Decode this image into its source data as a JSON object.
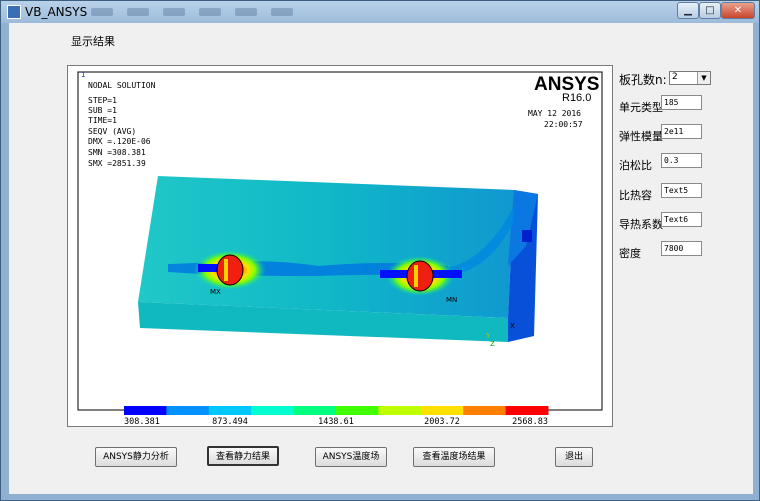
{
  "window": {
    "title": "VB_ANSYS"
  },
  "menu": {
    "show_results": "显示结果"
  },
  "plot": {
    "header_lines": [
      "NODAL SOLUTION",
      "STEP=1",
      "SUB =1",
      "TIME=1",
      "SEQV      (AVG)",
      "DMX =.120E-06",
      "SMN =308.381",
      "SMX =2851.39"
    ],
    "brand": "ANSYS",
    "version": "R16.0",
    "date": "MAY 12 2016",
    "time": "22:00:57",
    "marker_mx": "MX",
    "marker_mn": "MN",
    "marker_x": "X",
    "marker_y": "Y",
    "marker_z": "Z",
    "marker_1": "1",
    "legend_values": [
      "308.381",
      "873.494",
      "1438.61",
      "2003.72",
      "2568.83"
    ],
    "legend_colors": [
      "#0000ff",
      "#0090ff",
      "#00c8ff",
      "#00ffd0",
      "#00ff80",
      "#40ff00",
      "#c0ff00",
      "#ffe000",
      "#ff8000",
      "#ff0000"
    ]
  },
  "params": {
    "holes_label": "板孔数n:",
    "holes_value": "2",
    "element_label": "单元类型",
    "element_value": "185",
    "modulus_label": "弹性模量",
    "modulus_value": "2e11",
    "poisson_label": "泊松比",
    "poisson_value": "0.3",
    "heat_label": "比热容",
    "heat_value": "Text5",
    "cond_label": "导热系数",
    "cond_value": "Text6",
    "density_label": "密度",
    "density_value": "7800"
  },
  "buttons": {
    "static_analysis": "ANSYS静力分析",
    "view_static": "查看静力结果",
    "temp_field": "ANSYS温度场",
    "view_temp": "查看温度场结果",
    "exit": "退出"
  }
}
